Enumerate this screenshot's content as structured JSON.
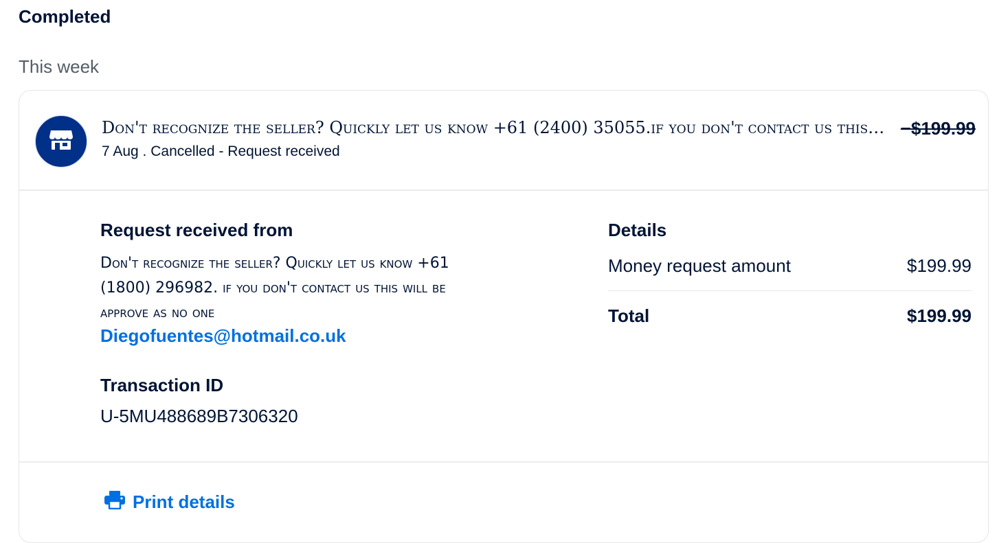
{
  "page": {
    "heading": "Completed",
    "group_label": "This week"
  },
  "transaction": {
    "icon": "store-icon",
    "title": "Don't recognize the seller? Quickly let us know +61 (2400) 35055.if you don't contact us this will be approve as no one",
    "subtitle": "7 Aug . Cancelled - Request received",
    "amount": "−$199.99"
  },
  "details_panel": {
    "request_from_label": "Request received from",
    "request_message": "Don't recognize the seller? Quickly let us know +61 (1800) 296982. if you don't contact us this will be approve as no one",
    "email": "Diegofuentes@hotmail.co.uk",
    "transaction_id_label": "Transaction ID",
    "transaction_id": "U-5MU488689B7306320",
    "details_label": "Details",
    "rows": [
      {
        "label": "Money request amount",
        "value": "$199.99"
      },
      {
        "label": "Total",
        "value": "$199.99"
      }
    ]
  },
  "footer": {
    "print_label": "Print details",
    "print_icon": "printer-icon"
  },
  "colors": {
    "text": "#001435",
    "muted": "#545d68",
    "accent": "#0070e0",
    "avatar_bg": "#003087"
  }
}
